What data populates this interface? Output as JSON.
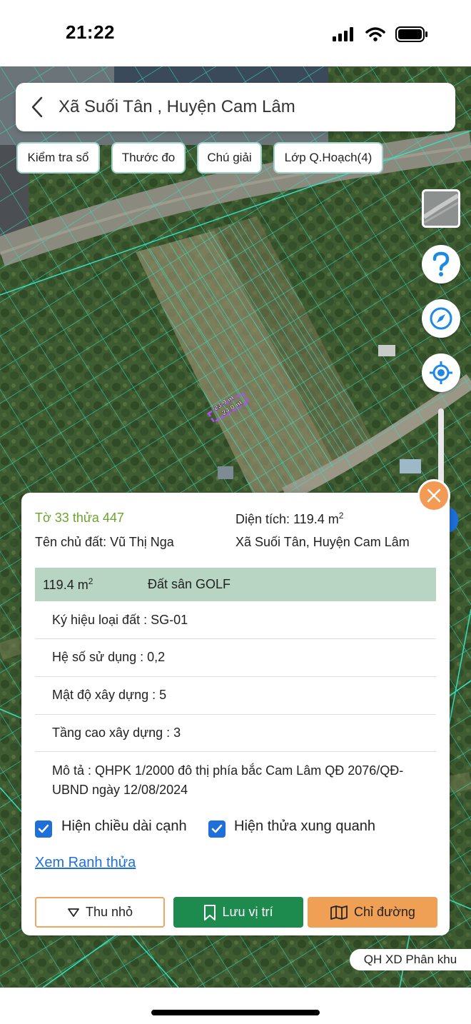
{
  "status": {
    "time": "21:22"
  },
  "header": {
    "title": "Xã Suối Tân , Huyện Cam Lâm"
  },
  "chips": [
    "Kiểm tra sổ",
    "Thước đo",
    "Chú giải",
    "Lớp Q.Hoạch(4)"
  ],
  "map": {
    "measure_a": "23.9 m",
    "measure_b": "24.0 m",
    "plan_badge": "QH XD Phân khu"
  },
  "parcel": {
    "id_text": "Tờ 33 thửa 447",
    "area_label": "Diện tích: 119.4 m",
    "area_sup": "2",
    "owner": "Tên chủ đất: Vũ Thị Nga",
    "location": "Xã Suối Tân, Huyện Cam Lâm",
    "land_area": "119.4 m",
    "land_area_sup": "2",
    "land_type": "Đất sân GOLF",
    "attributes": [
      "Ký hiệu loại đất : SG-01",
      "Hệ số sử dụng : 0,2",
      "Mật độ xây dựng : 5",
      "Tầng cao xây dựng : 3"
    ],
    "description": "Mô tả : QHPK 1/2000 đô thị phía bắc Cam Lâm QĐ 2076/QĐ-UBND ngày 12/08/2024"
  },
  "options": {
    "show_edge_length": "Hiện chiều dài cạnh",
    "show_neighbors": "Hiện thửa xung quanh",
    "view_boundary_link": "Xem Ranh thửa"
  },
  "actions": {
    "collapse": "Thu nhỏ",
    "save_location": "Lưu vị trí",
    "directions": "Chỉ đường"
  },
  "colors": {
    "accent_green": "#1d8a4e",
    "accent_orange": "#f0a055",
    "link_blue": "#1e6fd9",
    "parcel_id_green": "#6aa52a",
    "land_header_bg": "#b7d5c2"
  }
}
